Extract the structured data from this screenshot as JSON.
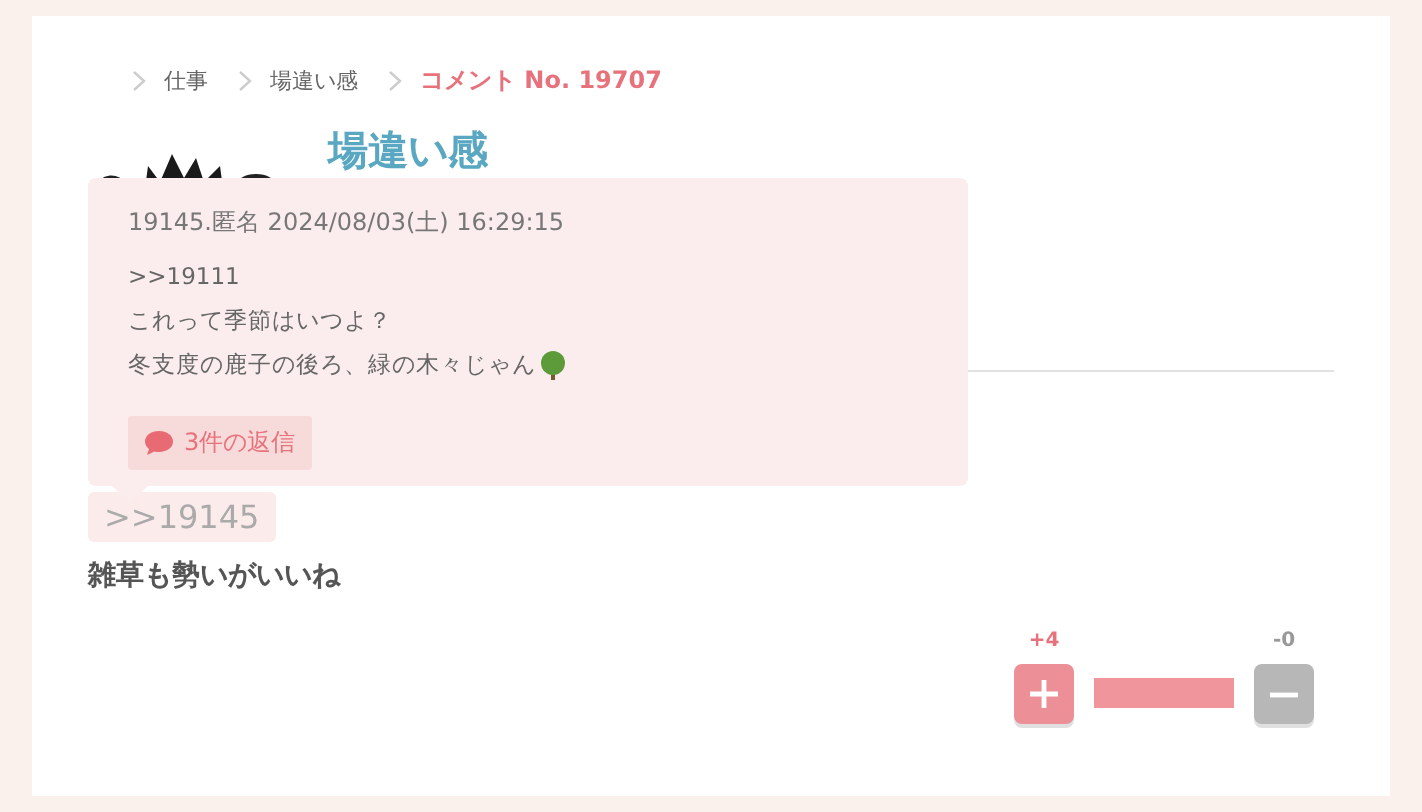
{
  "breadcrumb": [
    {
      "label": "仕事",
      "current": false
    },
    {
      "label": "場違い感",
      "current": false
    },
    {
      "label": "コメント No. 19707",
      "current": true
    }
  ],
  "topic": {
    "title": "場違い感"
  },
  "popup": {
    "header": "19145.匿名 2024/08/03(土) 16:29:15",
    "lines": [
      ">>19111",
      "これって季節はいつよ？",
      "冬支度の鹿子の後ろ、緑の木々じゃん"
    ],
    "reply_count": "3件の返信"
  },
  "comment": {
    "quote": ">>19145",
    "text": "雑草も勢いがいいね"
  },
  "votes": {
    "plus": "+4",
    "minus": "-0",
    "level": 1
  }
}
